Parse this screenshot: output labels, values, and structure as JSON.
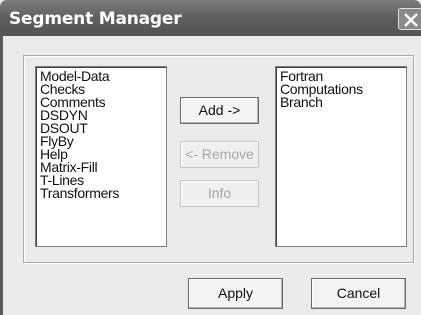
{
  "window": {
    "title": "Segment Manager",
    "close_icon": "close-icon"
  },
  "available_segments": {
    "items": [
      "Model-Data",
      "Checks",
      "Comments",
      "DSDYN",
      "DSOUT",
      "FlyBy",
      "Help",
      "Matrix-Fill",
      "T-Lines",
      "Transformers"
    ]
  },
  "selected_segments": {
    "items": [
      "Fortran",
      "Computations",
      "Branch"
    ]
  },
  "buttons": {
    "add": "Add ->",
    "remove": "<- Remove",
    "info": "Info",
    "apply": "Apply",
    "cancel": "Cancel"
  }
}
